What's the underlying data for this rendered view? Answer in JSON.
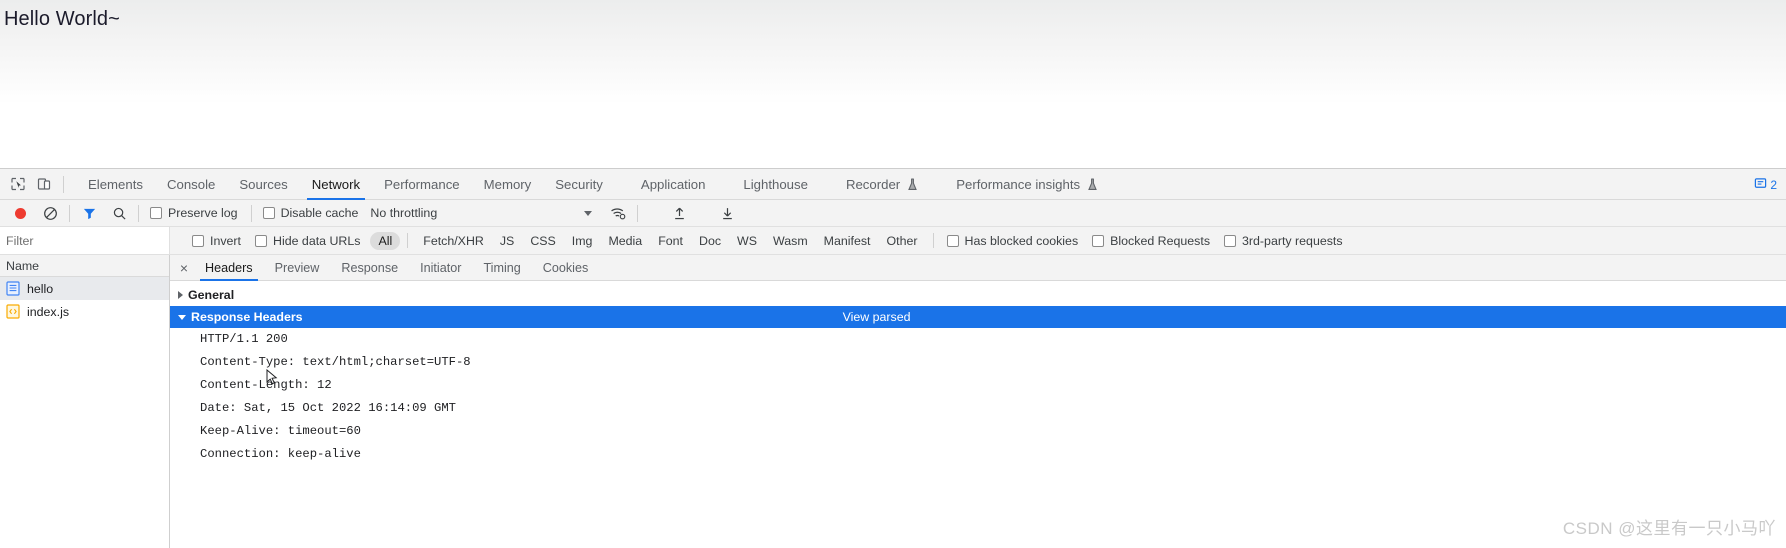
{
  "page": {
    "heading": "Hello World~"
  },
  "devtools": {
    "dock_icons": [
      "inspect-element-icon",
      "device-toolbar-icon"
    ],
    "tabs": [
      {
        "label": "Elements",
        "active": false,
        "experimental": false
      },
      {
        "label": "Console",
        "active": false,
        "experimental": false
      },
      {
        "label": "Sources",
        "active": false,
        "experimental": false
      },
      {
        "label": "Network",
        "active": true,
        "experimental": false
      },
      {
        "label": "Performance",
        "active": false,
        "experimental": false
      },
      {
        "label": "Memory",
        "active": false,
        "experimental": false
      },
      {
        "label": "Security",
        "active": false,
        "experimental": false
      },
      {
        "label": "Application",
        "active": false,
        "experimental": false
      },
      {
        "label": "Lighthouse",
        "active": false,
        "experimental": false
      },
      {
        "label": "Recorder",
        "active": false,
        "experimental": true
      },
      {
        "label": "Performance insights",
        "active": false,
        "experimental": true
      }
    ],
    "message_badge": {
      "icon": "message-icon",
      "count": "2"
    },
    "network_toolbar": {
      "record_button": "record-icon",
      "clear_button": "clear-icon",
      "filter_button": "filter-icon",
      "search_button": "search-icon",
      "preserve_log": "Preserve log",
      "disable_cache": "Disable cache",
      "throttling": "No throttling",
      "network_conditions": "network-conditions-icon",
      "import_har": "import-har-icon",
      "export_har": "export-har-icon"
    },
    "filter_bar": {
      "filter_placeholder": "Filter",
      "filter_value": "",
      "invert": "Invert",
      "hide_data_urls": "Hide data URLs",
      "types": [
        {
          "label": "All",
          "selected": true
        },
        {
          "label": "Fetch/XHR",
          "selected": false
        },
        {
          "label": "JS",
          "selected": false
        },
        {
          "label": "CSS",
          "selected": false
        },
        {
          "label": "Img",
          "selected": false
        },
        {
          "label": "Media",
          "selected": false
        },
        {
          "label": "Font",
          "selected": false
        },
        {
          "label": "Doc",
          "selected": false
        },
        {
          "label": "WS",
          "selected": false
        },
        {
          "label": "Wasm",
          "selected": false
        },
        {
          "label": "Manifest",
          "selected": false
        },
        {
          "label": "Other",
          "selected": false
        }
      ],
      "has_blocked_cookies": "Has blocked cookies",
      "blocked_requests": "Blocked Requests",
      "third_party_requests": "3rd-party requests"
    },
    "request_list": {
      "column_header": "Name",
      "rows": [
        {
          "name": "hello",
          "icon": "document-file-icon",
          "selected": true
        },
        {
          "name": "index.js",
          "icon": "script-file-icon",
          "selected": false
        }
      ]
    },
    "detail": {
      "close_label": "×",
      "tabs": [
        {
          "label": "Headers",
          "active": true
        },
        {
          "label": "Preview",
          "active": false
        },
        {
          "label": "Response",
          "active": false
        },
        {
          "label": "Initiator",
          "active": false
        },
        {
          "label": "Timing",
          "active": false
        },
        {
          "label": "Cookies",
          "active": false
        }
      ],
      "sections": {
        "general": {
          "title": "General",
          "expanded": false
        },
        "response_headers": {
          "title": "Response Headers",
          "expanded": true,
          "view_parsed": "View parsed",
          "lines": [
            "HTTP/1.1 200",
            "Content-Type: text/html;charset=UTF-8",
            "Content-Length: 12",
            "Date: Sat, 15 Oct 2022 16:14:09 GMT",
            "Keep-Alive: timeout=60",
            "Connection: keep-alive"
          ]
        }
      }
    }
  },
  "watermark": "CSDN @这里有一只小马吖",
  "colors": {
    "accent": "#1a73e8",
    "record": "#ee3b30",
    "filter_active": "#1a73e8",
    "toolbar_bg": "#f3f3f3"
  }
}
